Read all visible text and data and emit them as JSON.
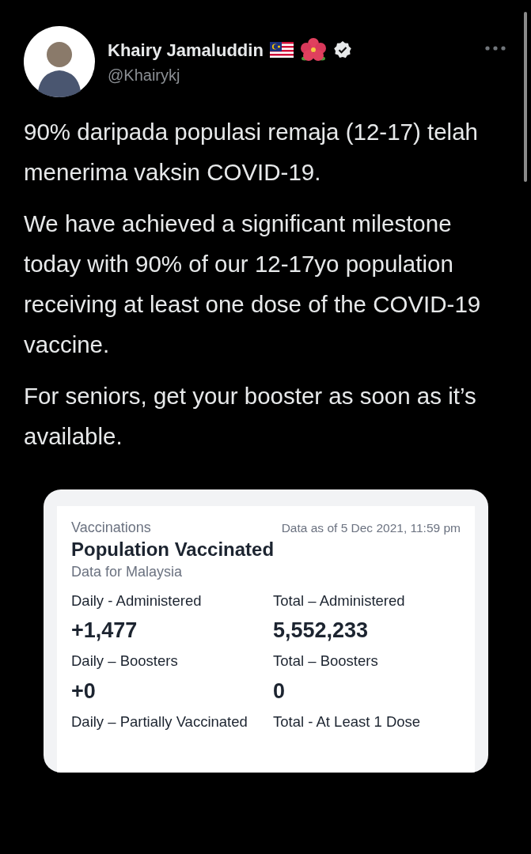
{
  "author": {
    "name": "Khairy Jamaluddin",
    "handle": "@Khairykj",
    "verified": true
  },
  "tweet": {
    "paragraphs": [
      "90% daripada populasi remaja (12-17) telah menerima vaksin COVID-19.",
      "We have achieved a significant milestone today with 90% of our 12-17yo population receiving at least one dose of the COVID-19 vaccine.",
      "For seniors, get your booster as soon as it’s available."
    ]
  },
  "card": {
    "section": "Vaccinations",
    "timestamp": "Data as of 5 Dec 2021, 11:59 pm",
    "title": "Population Vaccinated",
    "subtitle": "Data for Malaysia",
    "stats": [
      {
        "label": "Daily - Administered",
        "value": "+1,477"
      },
      {
        "label": "Total – Administered",
        "value": "5,552,233"
      },
      {
        "label": "Daily – Boosters",
        "value": "+0"
      },
      {
        "label": "Total – Boosters",
        "value": "0"
      },
      {
        "label": "Daily – Partially Vaccinated"
      },
      {
        "label": "Total - At Least 1 Dose"
      }
    ]
  }
}
